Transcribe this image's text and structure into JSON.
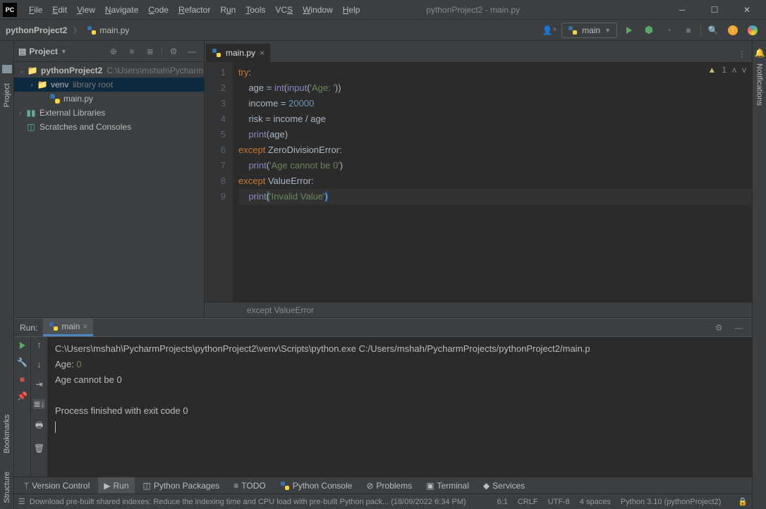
{
  "window": {
    "title": "pythonProject2 - main.py"
  },
  "menu": [
    "File",
    "Edit",
    "View",
    "Navigate",
    "Code",
    "Refactor",
    "Run",
    "Tools",
    "VCS",
    "Window",
    "Help"
  ],
  "crumb": {
    "project": "pythonProject2",
    "file": "main.py"
  },
  "run_config": {
    "name": "main"
  },
  "project_tool": {
    "title": "Project",
    "root": "pythonProject2",
    "root_path": "C:\\Users\\mshah\\Pycharm",
    "venv": "venv",
    "venv_note": "library root",
    "main": "main.py",
    "ext_libs": "External Libraries",
    "scratch": "Scratches and Consoles"
  },
  "editor": {
    "tab": "main.py",
    "lines": [
      "1",
      "2",
      "3",
      "4",
      "5",
      "6",
      "7",
      "8",
      "9"
    ],
    "warn_count": "1",
    "breadcrumb": "except ValueError"
  },
  "code": {
    "l1": {
      "try": "try",
      "c": ":"
    },
    "l2": {
      "a": "    age = ",
      "int": "int",
      "p1": "(",
      "inp": "input",
      "p2": "(",
      "s": "'Age: '",
      "p3": "))"
    },
    "l3": {
      "a": "    income = ",
      "n": "20000"
    },
    "l4": {
      "a": "    risk = income / age"
    },
    "l5": {
      "a": "    ",
      "pr": "print",
      "b": "(age)"
    },
    "l6": {
      "ex": "except ",
      "cls": "ZeroDivisionError",
      "c": ":"
    },
    "l7": {
      "a": "    ",
      "pr": "print",
      "p1": "(",
      "s": "'Age cannot be 0'",
      "p2": ")"
    },
    "l8": {
      "ex": "except ",
      "cls": "ValueError",
      "c": ":"
    },
    "l9": {
      "a": "    ",
      "pr": "print",
      "p1": "(",
      "s": "'Invalid Value'",
      "p2": ")"
    }
  },
  "run_tool": {
    "label": "Run:",
    "tab": "main",
    "l1": "C:\\Users\\mshah\\PycharmProjects\\pythonProject2\\venv\\Scripts\\python.exe C:/Users/mshah/PycharmProjects/pythonProject2/main.p",
    "l2a": "Age: ",
    "l2b": "0",
    "l3": "Age cannot be 0",
    "l4": "Process finished with exit code 0"
  },
  "bottom": {
    "vcs": "Version Control",
    "run": "Run",
    "pkg": "Python Packages",
    "todo": "TODO",
    "console": "Python Console",
    "problems": "Problems",
    "terminal": "Terminal",
    "services": "Services"
  },
  "status": {
    "msg": "Download pre-built shared indexes: Reduce the indexing time and CPU load with pre-built Python pack... (18/09/2022 6:34 PM)",
    "pos": "6:1",
    "sep": "CRLF",
    "enc": "UTF-8",
    "indent": "4 spaces",
    "py": "Python 3.10 (pythonProject2)"
  },
  "gutters": {
    "project": "Project",
    "bookmarks": "Bookmarks",
    "structure": "Structure",
    "notifications": "Notifications"
  }
}
